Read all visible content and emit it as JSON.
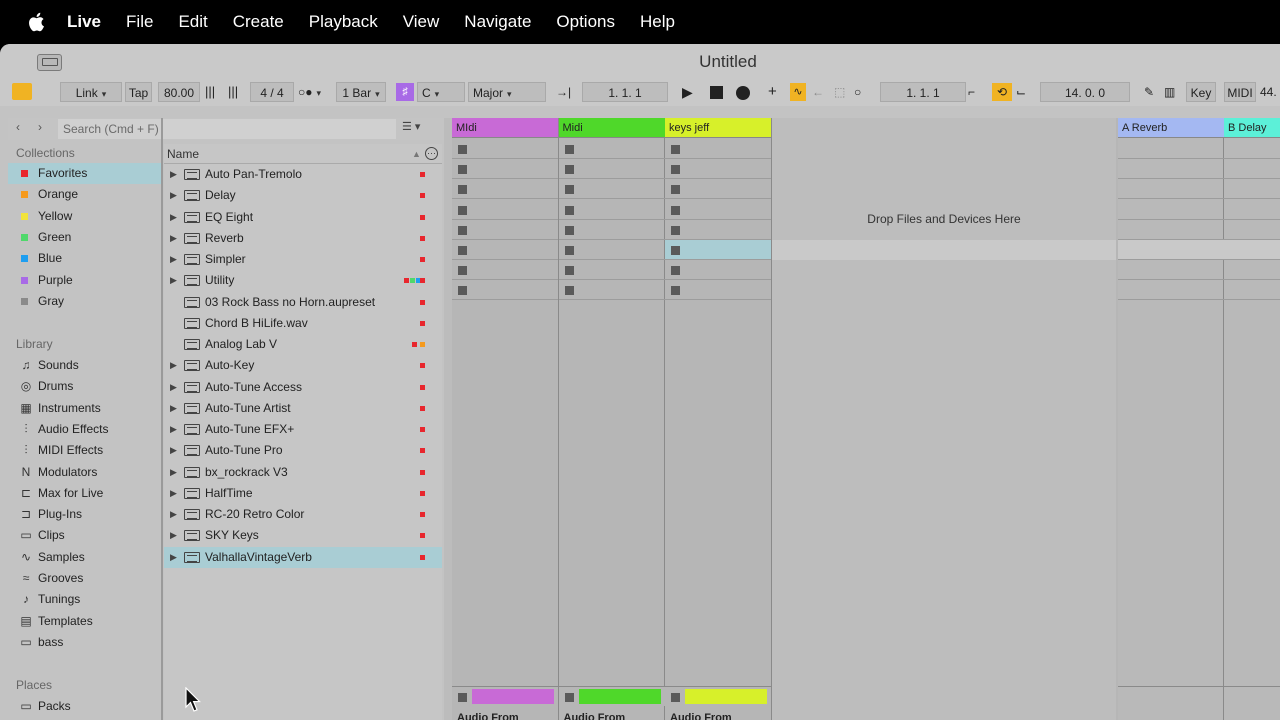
{
  "menubar": {
    "items": [
      "Live",
      "File",
      "Edit",
      "Create",
      "Playback",
      "View",
      "Navigate",
      "Options",
      "Help"
    ]
  },
  "window": {
    "title": "Untitled"
  },
  "transport": {
    "link": "Link",
    "tap": "Tap",
    "tempo": "80.00",
    "signature": "4 / 4",
    "quantize": "1 Bar",
    "key": "C",
    "scale": "Major",
    "arrangement_position": "1.   1.   1",
    "loop_start": "1.   1.   1",
    "loop_length": "14.   0.   0",
    "key_map": "Key",
    "midi_map": "MIDI",
    "cpu": "44."
  },
  "browser": {
    "search_placeholder": "Search (Cmd + F)",
    "collections_header": "Collections",
    "collections": [
      {
        "label": "Favorites",
        "color": "#e8262d",
        "selected": true
      },
      {
        "label": "Orange",
        "color": "#f59a1d"
      },
      {
        "label": "Yellow",
        "color": "#f2e33a"
      },
      {
        "label": "Green",
        "color": "#4fd86b"
      },
      {
        "label": "Blue",
        "color": "#1e9ef0"
      },
      {
        "label": "Purple",
        "color": "#a86ae6"
      },
      {
        "label": "Gray",
        "color": "#8a8a8a"
      }
    ],
    "library_header": "Library",
    "library": [
      {
        "label": "Sounds",
        "icon": "note-icon"
      },
      {
        "label": "Drums",
        "icon": "drum-icon"
      },
      {
        "label": "Instruments",
        "icon": "instrument-icon"
      },
      {
        "label": "Audio Effects",
        "icon": "audio-effects-icon"
      },
      {
        "label": "MIDI Effects",
        "icon": "midi-effects-icon"
      },
      {
        "label": "Modulators",
        "icon": "modulators-icon"
      },
      {
        "label": "Max for Live",
        "icon": "max-icon"
      },
      {
        "label": "Plug-Ins",
        "icon": "plugin-icon"
      },
      {
        "label": "Clips",
        "icon": "clips-icon"
      },
      {
        "label": "Samples",
        "icon": "samples-icon"
      },
      {
        "label": "Grooves",
        "icon": "grooves-icon"
      },
      {
        "label": "Tunings",
        "icon": "tunings-icon"
      },
      {
        "label": "Templates",
        "icon": "templates-icon"
      },
      {
        "label": "bass",
        "icon": "folder-icon"
      }
    ],
    "places_header": "Places",
    "places": [
      {
        "label": "Packs",
        "icon": "packs-icon"
      }
    ],
    "name_column": "Name",
    "items": [
      {
        "label": "Auto Pan-Tremolo",
        "expandable": true
      },
      {
        "label": "Delay",
        "expandable": true
      },
      {
        "label": "EQ Eight",
        "expandable": true
      },
      {
        "label": "Reverb",
        "expandable": true
      },
      {
        "label": "Simpler",
        "expandable": true
      },
      {
        "label": "Utility",
        "expandable": true,
        "multi_tag": true
      },
      {
        "label": "03 Rock Bass no Horn.aupreset",
        "expandable": false
      },
      {
        "label": "Chord B HiLife.wav",
        "expandable": false
      },
      {
        "label": "Analog Lab V",
        "expandable": false,
        "tag2": "orange"
      },
      {
        "label": "Auto-Key",
        "expandable": true
      },
      {
        "label": "Auto-Tune Access",
        "expandable": true
      },
      {
        "label": "Auto-Tune Artist",
        "expandable": true
      },
      {
        "label": "Auto-Tune EFX+",
        "expandable": true
      },
      {
        "label": "Auto-Tune Pro",
        "expandable": true
      },
      {
        "label": "bx_rockrack V3",
        "expandable": true
      },
      {
        "label": "HalfTime",
        "expandable": true
      },
      {
        "label": "RC-20 Retro Color",
        "expandable": true
      },
      {
        "label": "SKY Keys",
        "expandable": true
      },
      {
        "label": "ValhallaVintageVerb",
        "expandable": true,
        "selected": true
      }
    ]
  },
  "session": {
    "tracks": [
      {
        "name": "MIdi",
        "color": "#c86ad6"
      },
      {
        "name": "Midi",
        "color": "#4fd82a"
      },
      {
        "name": "keys jeff",
        "color": "#d7f02a"
      }
    ],
    "drop_text": "Drop Files and Devices Here",
    "returns": [
      {
        "name": "A Reverb",
        "color": "#a4b8f2"
      },
      {
        "name": "B Delay",
        "color": "#5cf0d8"
      }
    ],
    "audio_from_label": "Audio From"
  }
}
